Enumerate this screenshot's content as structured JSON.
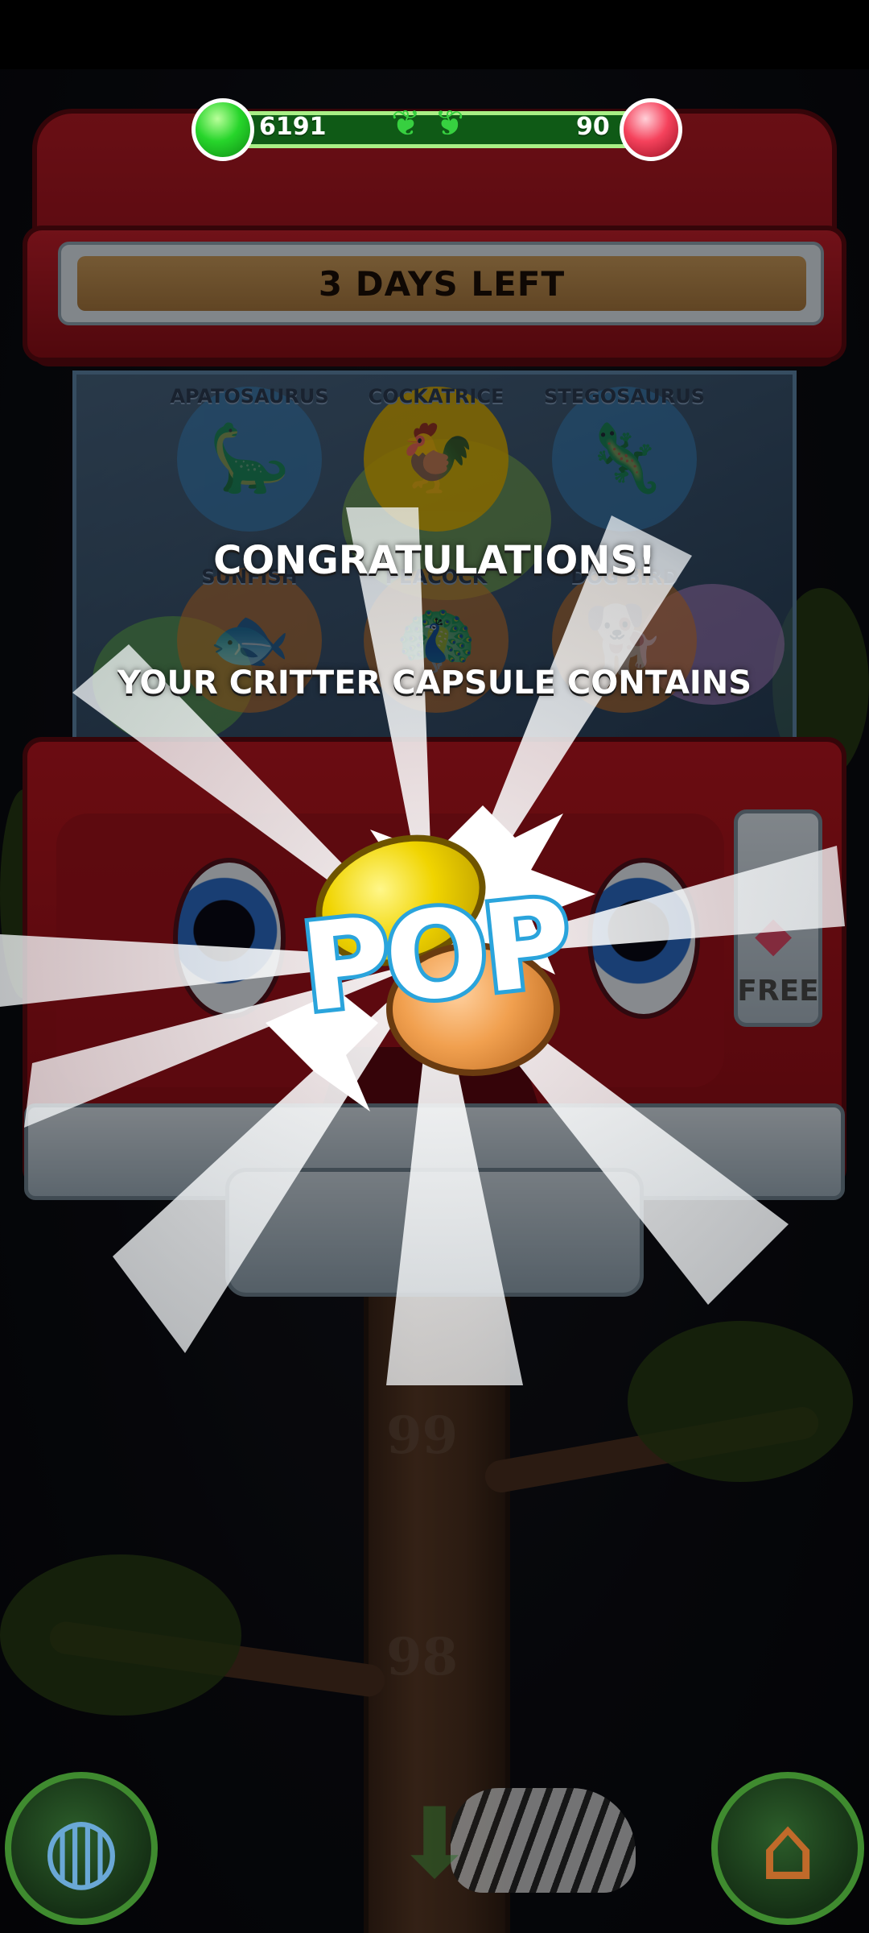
{
  "currency": {
    "green_gems": "6191",
    "red_gems": "90"
  },
  "machine": {
    "banner": "3 DAYS LEFT",
    "critters": [
      {
        "name": "APATOSAURUS",
        "color": "#3a8ed0",
        "art": "🦕"
      },
      {
        "name": "COCKATRICE",
        "color": "#e3b300",
        "art": "🐓"
      },
      {
        "name": "STEGOSAURUS",
        "color": "#3a8ed0",
        "art": "🦎"
      },
      {
        "name": "SUNFISH",
        "color": "#d77a2a",
        "art": "🐟"
      },
      {
        "name": "PEACOCK",
        "color": "#d77a2a",
        "art": "🦚"
      },
      {
        "name": "DOG BIRD",
        "color": "#d77a2a",
        "art": "🐕"
      }
    ],
    "free_label": "FREE"
  },
  "reward": {
    "congrats": "CONGRATULATIONS!",
    "subtitle": "YOUR CRITTER CAPSULE CONTAINS",
    "pop": "POP"
  },
  "tree_levels": [
    "99",
    "98"
  ],
  "icons": {
    "globe": "globe-icon",
    "house": "house-icon",
    "down": "down-arrow-icon"
  }
}
